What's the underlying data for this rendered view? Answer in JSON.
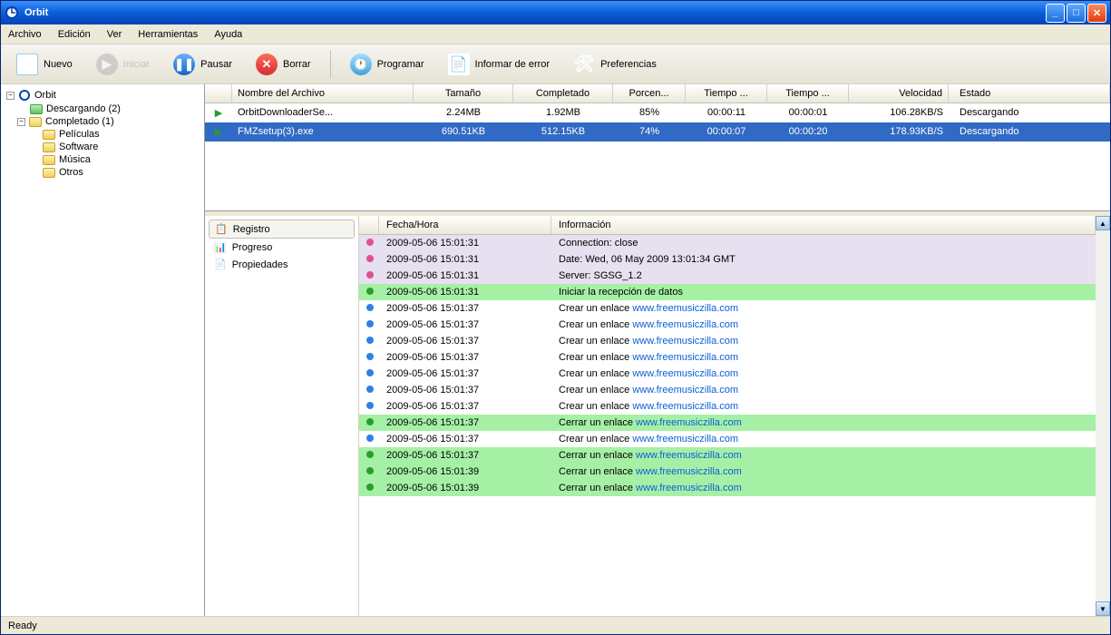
{
  "window": {
    "title": "Orbit"
  },
  "menu": {
    "archivo": "Archivo",
    "edicion": "Edición",
    "ver": "Ver",
    "herramientas": "Herramientas",
    "ayuda": "Ayuda"
  },
  "toolbar": {
    "nuevo": "Nuevo",
    "iniciar": "Iniciar",
    "pausar": "Pausar",
    "borrar": "Borrar",
    "programar": "Programar",
    "informar": "Informar de error",
    "preferencias": "Preferencias"
  },
  "tree": {
    "root": "Orbit",
    "descargando": "Descargando  (2)",
    "completado": "Completado  (1)",
    "peliculas": "Películas",
    "software": "Software",
    "musica": "Música",
    "otros": "Otros"
  },
  "downloads": {
    "headers": {
      "name": "Nombre del Archivo",
      "size": "Tamaño",
      "completed": "Completado",
      "percent": "Porcen...",
      "time1": "Tiempo ...",
      "time2": "Tiempo ...",
      "speed": "Velocidad",
      "status": "Estado"
    },
    "rows": [
      {
        "name": "OrbitDownloaderSe...",
        "size": "2.24MB",
        "completed": "1.92MB",
        "percent": "85%",
        "time1": "00:00:11",
        "time2": "00:00:01",
        "speed": "106.28KB/S",
        "status": "Descargando",
        "selected": false
      },
      {
        "name": "FMZsetup(3).exe",
        "size": "690.51KB",
        "completed": "512.15KB",
        "percent": "74%",
        "time1": "00:00:07",
        "time2": "00:00:20",
        "speed": "178.93KB/S",
        "status": "Descargando",
        "selected": true
      }
    ]
  },
  "tabs": {
    "registro": "Registro",
    "progreso": "Progreso",
    "propiedades": "Propiedades"
  },
  "log": {
    "headers": {
      "time": "Fecha/Hora",
      "info": "Información"
    },
    "rows": [
      {
        "type": "lav",
        "icon": "pink",
        "time": "2009-05-06 15:01:31",
        "info": "Connection: close"
      },
      {
        "type": "lav",
        "icon": "pink",
        "time": "2009-05-06 15:01:31",
        "info": "Date: Wed, 06 May 2009 13:01:34 GMT"
      },
      {
        "type": "lav",
        "icon": "pink",
        "time": "2009-05-06 15:01:31",
        "info": "Server: SGSG_1.2"
      },
      {
        "type": "green",
        "icon": "green",
        "time": "2009-05-06 15:01:31",
        "info": "Iniciar la recepción de datos"
      },
      {
        "type": "",
        "icon": "blue",
        "time": "2009-05-06 15:01:37",
        "info": "Crear un enlace ",
        "link": "www.freemusiczilla.com"
      },
      {
        "type": "",
        "icon": "blue",
        "time": "2009-05-06 15:01:37",
        "info": "Crear un enlace ",
        "link": "www.freemusiczilla.com"
      },
      {
        "type": "",
        "icon": "blue",
        "time": "2009-05-06 15:01:37",
        "info": "Crear un enlace ",
        "link": "www.freemusiczilla.com"
      },
      {
        "type": "",
        "icon": "blue",
        "time": "2009-05-06 15:01:37",
        "info": "Crear un enlace ",
        "link": "www.freemusiczilla.com"
      },
      {
        "type": "",
        "icon": "blue",
        "time": "2009-05-06 15:01:37",
        "info": "Crear un enlace ",
        "link": "www.freemusiczilla.com"
      },
      {
        "type": "",
        "icon": "blue",
        "time": "2009-05-06 15:01:37",
        "info": "Crear un enlace ",
        "link": "www.freemusiczilla.com"
      },
      {
        "type": "",
        "icon": "blue",
        "time": "2009-05-06 15:01:37",
        "info": "Crear un enlace ",
        "link": "www.freemusiczilla.com"
      },
      {
        "type": "green",
        "icon": "green",
        "time": "2009-05-06 15:01:37",
        "info": "Cerrar un enlace ",
        "link": "www.freemusiczilla.com"
      },
      {
        "type": "",
        "icon": "blue",
        "time": "2009-05-06 15:01:37",
        "info": "Crear un enlace ",
        "link": "www.freemusiczilla.com"
      },
      {
        "type": "green",
        "icon": "green",
        "time": "2009-05-06 15:01:37",
        "info": "Cerrar un enlace ",
        "link": "www.freemusiczilla.com"
      },
      {
        "type": "green",
        "icon": "green",
        "time": "2009-05-06 15:01:39",
        "info": "Cerrar un enlace ",
        "link": "www.freemusiczilla.com"
      },
      {
        "type": "green",
        "icon": "green",
        "time": "2009-05-06 15:01:39",
        "info": "Cerrar un enlace ",
        "link": "www.freemusiczilla.com"
      }
    ]
  },
  "status": {
    "ready": "Ready"
  }
}
